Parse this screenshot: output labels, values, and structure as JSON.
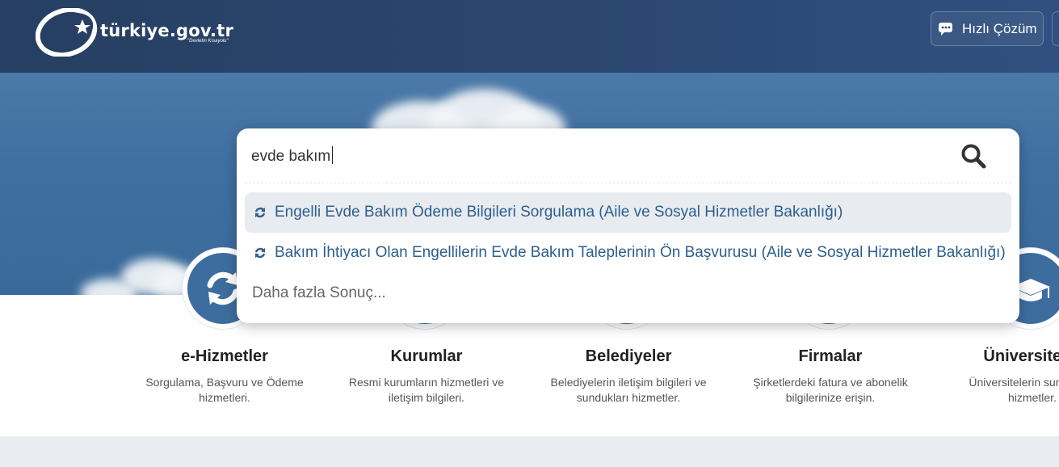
{
  "header": {
    "logo_text": "türkiye.gov.tr",
    "logo_sub": "\"Devletin Kısayolu\"",
    "quick_solution_label": "Hızlı Çözüm"
  },
  "search": {
    "value": "evde bakım",
    "suggestions": [
      {
        "label": "Engelli Evde Bakım Ödeme Bilgileri Sorgulama (Aile ve Sosyal Hizmetler Bakanlığı)",
        "icon": "refresh-icon"
      },
      {
        "label": "Bakım İhtiyacı Olan Engellilerin Evde Bakım Taleplerinin Ön Başvurusu (Aile ve Sosyal Hizmetler Bakanlığı)",
        "icon": "refresh-icon"
      }
    ],
    "more_label": "Daha fazla Sonuç..."
  },
  "services": [
    {
      "title": "e-Hizmetler",
      "desc": "Sorgulama, Başvuru ve Ödeme hizmetleri.",
      "icon": "refresh-icon"
    },
    {
      "title": "Kurumlar",
      "desc": "Resmi kurumların hizmetleri ve iletişim bilgileri.",
      "icon": "building-icon"
    },
    {
      "title": "Belediyeler",
      "desc": "Belediyelerin iletişim bilgileri ve sundukları hizmetler.",
      "icon": "city-icon"
    },
    {
      "title": "Firmalar",
      "desc": "Şirketlerdeki fatura ve abonelik bilgilerinize erişin.",
      "icon": "briefcase-icon"
    },
    {
      "title": "Üniversiteler",
      "desc": "Üniversitelerin sundukları hizmetler.",
      "icon": "graduation-cap-icon"
    }
  ],
  "colors": {
    "header": "#263f62",
    "accent": "#3d6d9e",
    "link": "#2d5e8e"
  }
}
